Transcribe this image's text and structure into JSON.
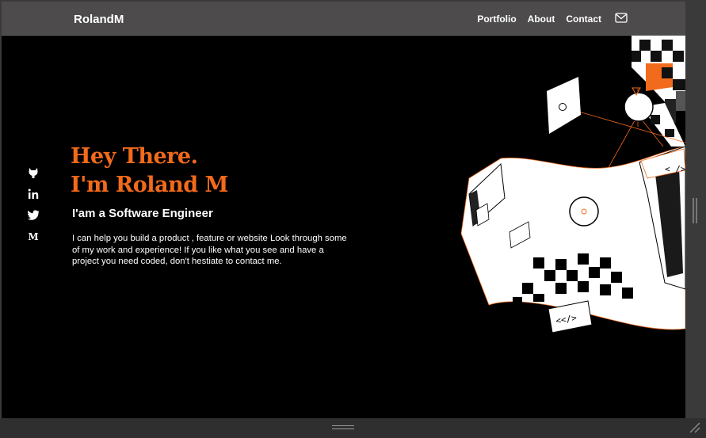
{
  "window": {
    "accent_color": "#f26a1b"
  },
  "navbar": {
    "brand": "RolandM",
    "links": [
      "Portfolio",
      "About",
      "Contact"
    ],
    "mail_icon": "mail-icon"
  },
  "social": {
    "icons": [
      "github-icon",
      "linkedin-icon",
      "twitter-icon",
      "medium-icon"
    ],
    "medium_glyph": "M"
  },
  "hero": {
    "line1": "Hey There.",
    "line2": "I'm Roland M",
    "subtitle": "I'am a Software Engineer",
    "description": "I can help you build a product , feature or website Look through some of my work and experience! If you like what you see and have a project you need coded, don't hestiate to contact me."
  },
  "illustration": {
    "code_tag_top": "<_/>",
    "code_tag_bottom": "<</>"
  }
}
